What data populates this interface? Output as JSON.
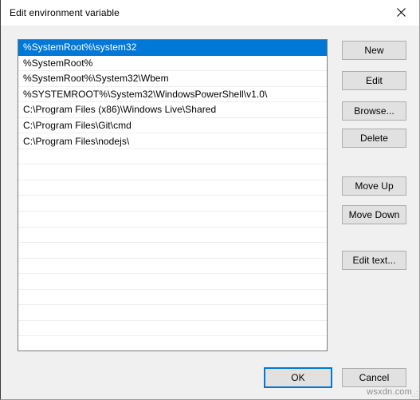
{
  "window": {
    "title": "Edit environment variable",
    "close_icon": "close-icon"
  },
  "listbox": {
    "selected_index": 0,
    "selection_color": "#0078d7",
    "total_visible_rows": 20,
    "entries": [
      "%SystemRoot%\\system32",
      "%SystemRoot%",
      "%SystemRoot%\\System32\\Wbem",
      "%SYSTEMROOT%\\System32\\WindowsPowerShell\\v1.0\\",
      "C:\\Program Files (x86)\\Windows Live\\Shared",
      "C:\\Program Files\\Git\\cmd",
      "C:\\Program Files\\nodejs\\"
    ]
  },
  "side_buttons": {
    "new": "New",
    "edit": "Edit",
    "browse": "Browse...",
    "delete": "Delete",
    "move_up": "Move Up",
    "move_down": "Move Down",
    "edit_text": "Edit text..."
  },
  "footer": {
    "ok": "OK",
    "cancel": "Cancel",
    "default_button": "OK",
    "focus_color": "#0078d7"
  },
  "watermark": {
    "text": "wsxdn.com"
  }
}
